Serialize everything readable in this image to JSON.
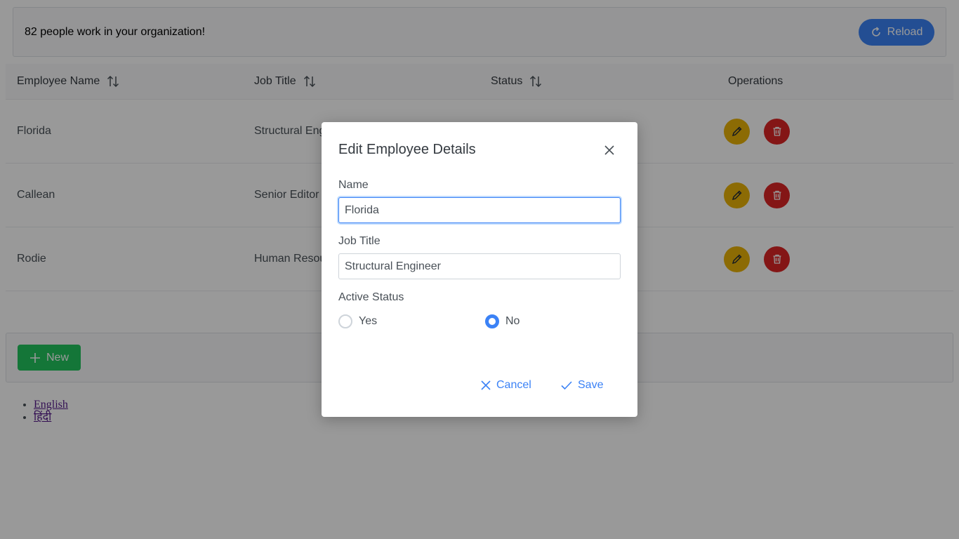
{
  "header": {
    "summary": "82 people work in your organization!",
    "reload_label": "Reload"
  },
  "table": {
    "columns": [
      "Employee Name",
      "Job Title",
      "Status",
      "Operations"
    ],
    "rows": [
      {
        "name": "Florida",
        "job_title": "Structural Eng"
      },
      {
        "name": "Callean",
        "job_title": "Senior Editor"
      },
      {
        "name": "Rodie",
        "job_title": "Human Resou"
      }
    ]
  },
  "footer": {
    "new_label": "New"
  },
  "languages": [
    "English",
    "हिंदी"
  ],
  "dialog": {
    "title": "Edit Employee Details",
    "name_label": "Name",
    "name_value": "Florida",
    "job_label": "Job Title",
    "job_value": "Structural Engineer",
    "status_label": "Active Status",
    "yes_label": "Yes",
    "no_label": "No",
    "selected_status": "No",
    "cancel_label": "Cancel",
    "save_label": "Save"
  },
  "colors": {
    "primary": "#3b82f6",
    "success": "#22c55e",
    "warning": "#eab308",
    "danger": "#dc2626"
  },
  "icons": {
    "reload": "refresh-icon",
    "sort": "sort-arrows-icon",
    "edit": "pencil-icon",
    "delete": "trash-icon",
    "new": "plus-icon",
    "close": "close-icon",
    "cancel": "x-icon",
    "save": "check-icon"
  }
}
